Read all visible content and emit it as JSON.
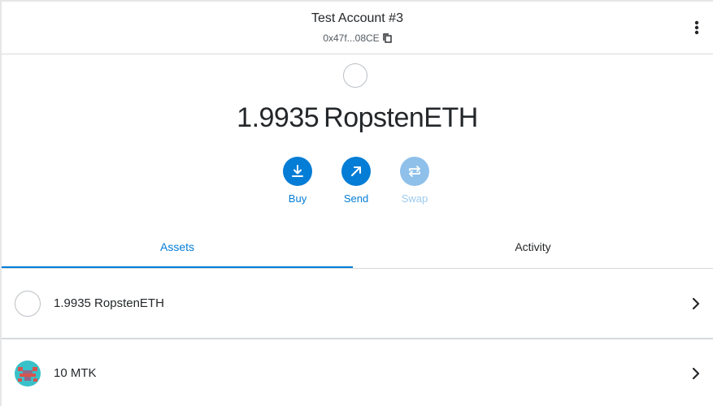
{
  "header": {
    "account_name": "Test Account #3",
    "address": "0x47f...08CE"
  },
  "balance": {
    "amount": "1.9935",
    "currency": "RopstenETH"
  },
  "actions": {
    "buy": "Buy",
    "send": "Send",
    "swap": "Swap"
  },
  "tabs": {
    "assets": "Assets",
    "activity": "Activity",
    "active": "assets"
  },
  "assets": [
    {
      "label": "1.9935 RopstenETH",
      "icon": "empty-token-icon"
    },
    {
      "label": "10 MTK",
      "icon": "identicon-mtk"
    }
  ],
  "colors": {
    "accent": "#037dd6",
    "accent_disabled": "#8ec0ea",
    "text": "#24272a",
    "border": "#d6d9dc"
  }
}
